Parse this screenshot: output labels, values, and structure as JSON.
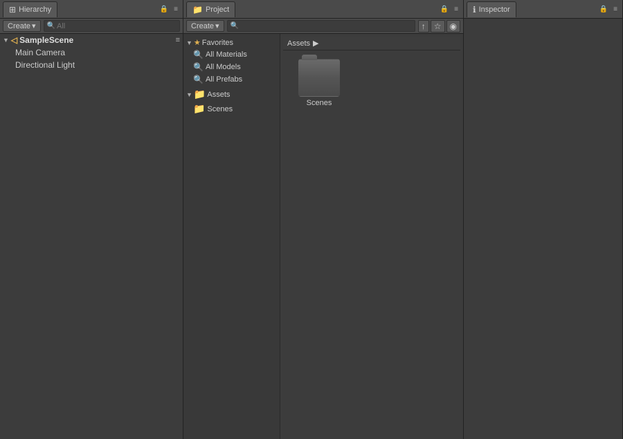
{
  "hierarchy": {
    "tab_label": "Hierarchy",
    "tab_icon": "⊞",
    "create_label": "Create",
    "search_placeholder": "All",
    "scene_name": "SampleScene",
    "children": [
      {
        "label": "Main Camera"
      },
      {
        "label": "Directional Light"
      }
    ],
    "menu_icon": "≡",
    "lock_icon": "🔒"
  },
  "project": {
    "tab_label": "Project",
    "tab_icon": "📁",
    "create_label": "Create",
    "search_placeholder": "",
    "favorites_label": "Favorites",
    "favorites_items": [
      {
        "label": "All Materials",
        "icon": "🔍"
      },
      {
        "label": "All Models",
        "icon": "🔍"
      },
      {
        "label": "All Prefabs",
        "icon": "🔍"
      }
    ],
    "assets_label": "Assets",
    "assets_children": [
      {
        "label": "Scenes",
        "icon": "📁"
      }
    ],
    "breadcrumb": "Assets",
    "breadcrumb_arrow": "▶",
    "main_items": [
      {
        "label": "Scenes"
      }
    ],
    "icon_search": "🔍",
    "icon_star": "☆",
    "icon_eye": "👁"
  },
  "inspector": {
    "tab_label": "Inspector",
    "tab_icon": "ℹ",
    "lock_icon": "🔒",
    "menu_icon": "≡"
  },
  "colors": {
    "accent": "#4a7c9e",
    "tab_bg": "#585858",
    "panel_bg": "#3c3c3c",
    "sidebar_bg": "#393939",
    "star_color": "#e0b050"
  }
}
